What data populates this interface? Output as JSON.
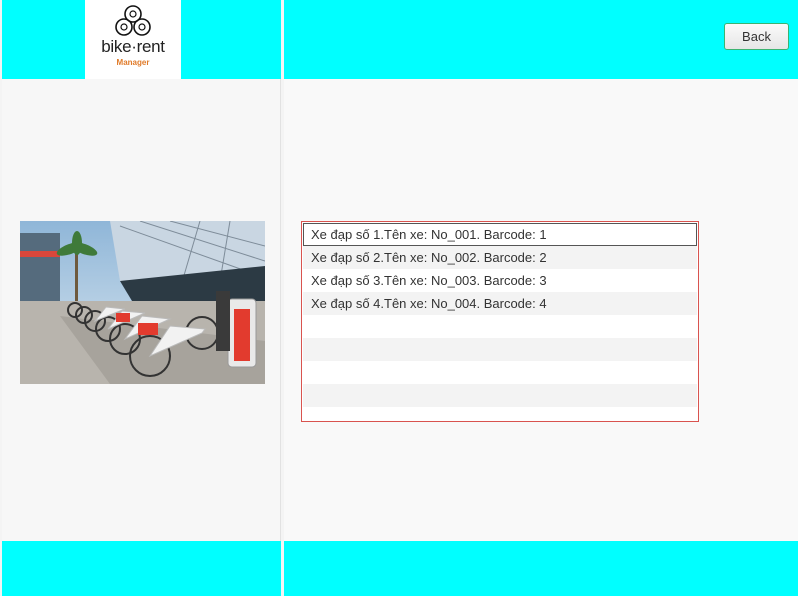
{
  "app": {
    "logo_text": "bike·rent",
    "logo_subtitle": "Manager",
    "logo_color": "#e07b2a"
  },
  "header": {
    "back_label": "Back"
  },
  "theme": {
    "header_bg": "#00ffff",
    "list_border": "#d9534f",
    "button_border": "#3cb371"
  },
  "image": {
    "icon": "bike-station-photo"
  },
  "bike_list": {
    "items": [
      "Xe đạp số 1.Tên xe: No_001. Barcode: 1",
      "Xe đạp số 2.Tên xe: No_002. Barcode: 2",
      "Xe đạp số 3.Tên xe: No_003. Barcode: 3",
      "Xe đạp số 4.Tên xe: No_004. Barcode: 4",
      "",
      "",
      "",
      ""
    ]
  }
}
